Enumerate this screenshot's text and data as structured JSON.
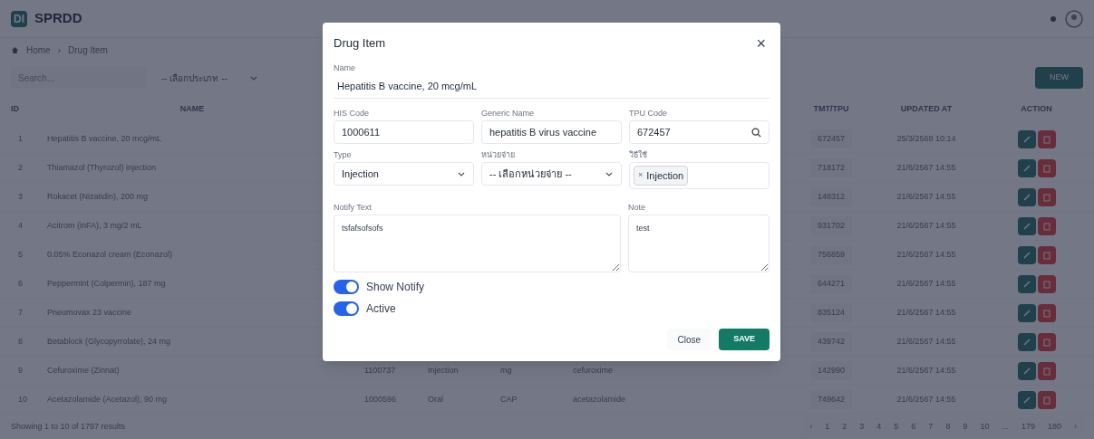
{
  "app": {
    "logo": "DI",
    "title": "SPRDD"
  },
  "breadcrumb": [
    "Home",
    "Drug Item"
  ],
  "breadcrumb_separator": "›",
  "search": {
    "placeholder": "Search..."
  },
  "filter": {
    "value": "-- เลือกประเภท --"
  },
  "new_button": "NEW",
  "table": {
    "columns": [
      "ID",
      "NAME",
      "TMT/TPU",
      "UPDATED AT",
      "ACTION"
    ],
    "rows": [
      {
        "id": "1",
        "name": "Hepatitis B vaccine, 20 mcg/mL",
        "hidden_cells": [],
        "tmt": "672457",
        "updated": "25/3/2568 10:14"
      },
      {
        "id": "2",
        "name": "Thiamazol (Thyrozol) injection",
        "hidden_cells": [],
        "tmt": "718172",
        "updated": "21/6/2567 14:55"
      },
      {
        "id": "3",
        "name": "Rokacet (Nizatidin), 200 mg",
        "hidden_cells": [],
        "tmt": "148312",
        "updated": "21/6/2567 14:55"
      },
      {
        "id": "4",
        "name": "Acitrom (inFA), 3 mg/2 mL",
        "hidden_cells": [],
        "tmt": "931702",
        "updated": "21/6/2567 14:55"
      },
      {
        "id": "5",
        "name": "0.05% Econazol cream (Econazol)",
        "hidden_cells": [],
        "tmt": "756859",
        "updated": "21/6/2567 14:55"
      },
      {
        "id": "6",
        "name": "Peppermint (Colpermin), 187 mg",
        "hidden_cells": [],
        "tmt": "644271",
        "updated": "21/6/2567 14:55"
      },
      {
        "id": "7",
        "name": "Pneumovax 23 vaccine",
        "hidden_cells": [],
        "tmt": "835124",
        "updated": "21/6/2567 14:55"
      },
      {
        "id": "8",
        "name": "Betablock (Glycopyrrolate), 24 mg",
        "hidden_cells": [],
        "tmt": "439742",
        "updated": "21/6/2567 14:55"
      },
      {
        "id": "9",
        "name": "Cefuroxime (Zinnat)",
        "hidden_cells": [
          "1100737",
          "Injection",
          "mg",
          "cefuroxime"
        ],
        "tmt": "142990",
        "updated": "21/6/2567 14:55"
      },
      {
        "id": "10",
        "name": "Acetazolamide (Acetazol), 90 mg",
        "hidden_cells": [
          "1000596",
          "Oral",
          "CAP",
          "acetazolamide"
        ],
        "tmt": "749642",
        "updated": "21/6/2567 14:55"
      }
    ]
  },
  "footer": {
    "summary": "Showing 1 to 10 of 1797 results",
    "pages": [
      "‹",
      "1",
      "2",
      "3",
      "4",
      "5",
      "6",
      "7",
      "8",
      "9",
      "10",
      "...",
      "179",
      "180",
      "›"
    ]
  },
  "dialog": {
    "title": "Drug Item",
    "close_icon": "×",
    "name": {
      "label": "Name",
      "value": "Hepatitis B vaccine, 20 mcg/mL"
    },
    "his_code": {
      "label": "HIS Code",
      "value": "1000611"
    },
    "generic_name": {
      "label": "Generic Name",
      "value": "hepatitis B virus vaccine"
    },
    "tpu_code": {
      "label": "TPU Code",
      "value": "672457"
    },
    "type": {
      "label": "Type",
      "value": "Injection"
    },
    "unit": {
      "label": "หน่วยจ่าย",
      "value": "-- เลือกหน่วยจ่าย --"
    },
    "usage": {
      "label": "วิธีใช้",
      "tags": [
        {
          "remove": "×",
          "label": "Injection"
        }
      ]
    },
    "notify_text": {
      "label": "Notify Text",
      "value": "tsfafsofsofs"
    },
    "note": {
      "label": "Note",
      "value": "test"
    },
    "toggles": [
      {
        "label": "Show Notify",
        "on": true
      },
      {
        "label": "Active",
        "on": true
      }
    ],
    "buttons": {
      "close": "Close",
      "save": "SAVE"
    }
  }
}
